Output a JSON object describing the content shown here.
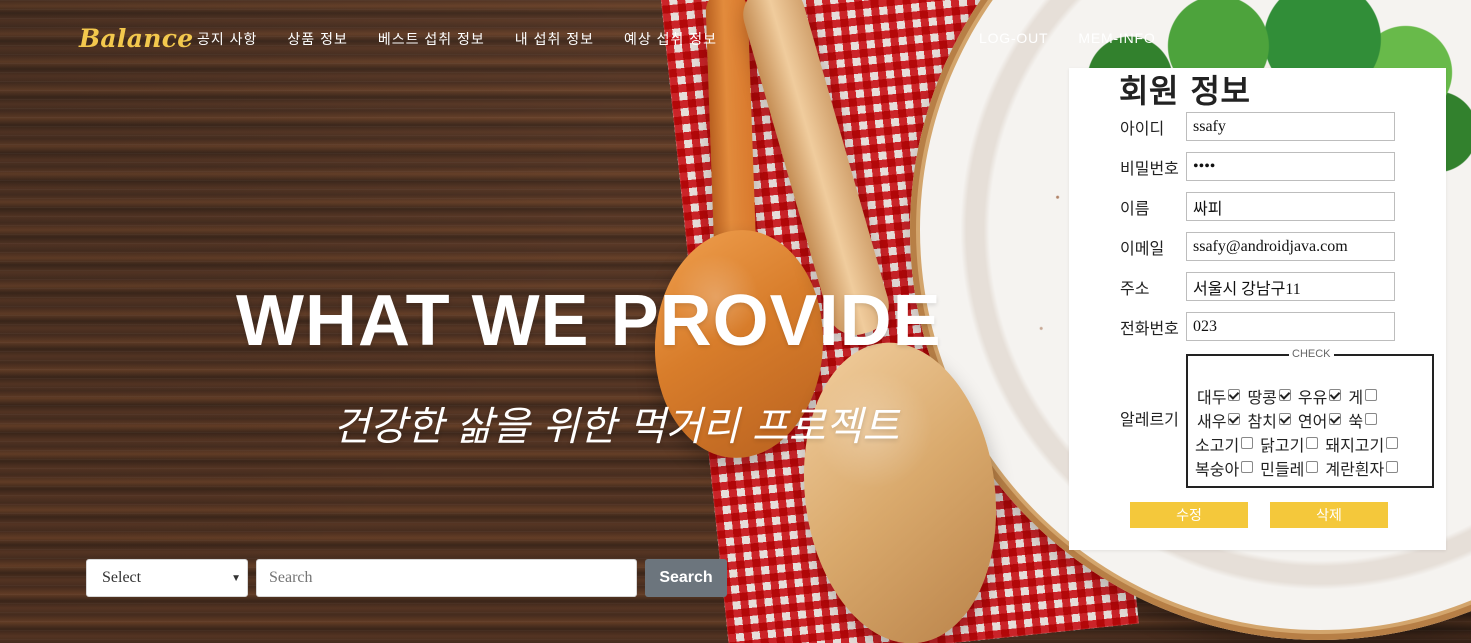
{
  "brand": {
    "logo": "Balance"
  },
  "navigation": {
    "items": [
      "공지 사항",
      "상품 정보",
      "베스트 섭취 정보",
      "내 섭취 정보",
      "예상 섭취 정보"
    ],
    "right_links": [
      "LOG-OUT",
      "MEM-INFO"
    ]
  },
  "hero": {
    "title": "WHAT WE PROVIDE",
    "subtitle": "건강한 삶을 위한 먹거리 프로젝트"
  },
  "search": {
    "select_value": "Select",
    "input_value": "",
    "input_placeholder": "Search",
    "button_label": "Search"
  },
  "member_info": {
    "title": "회원 정보",
    "fields": [
      {
        "label": "아이디",
        "value": "ssafy"
      },
      {
        "label": "비밀번호",
        "value": "••••"
      },
      {
        "label": "이름",
        "value": "싸피"
      },
      {
        "label": "이메일",
        "value": "ssafy@androidjava.com"
      },
      {
        "label": "주소",
        "value": "서울시 강남구11"
      },
      {
        "label": "전화번호",
        "value": "023"
      }
    ],
    "allergy": {
      "label": "알레르기",
      "legend": "CHECK",
      "rows": [
        [
          {
            "label": "대두",
            "checked": true
          },
          {
            "label": "땅콩",
            "checked": true
          },
          {
            "label": "우유",
            "checked": true
          },
          {
            "label": "게",
            "checked": false
          }
        ],
        [
          {
            "label": "새우",
            "checked": true
          },
          {
            "label": "참치",
            "checked": true
          },
          {
            "label": "연어",
            "checked": true
          },
          {
            "label": "쑥",
            "checked": false
          }
        ],
        [
          {
            "label": "소고기",
            "checked": false
          },
          {
            "label": "닭고기",
            "checked": false
          },
          {
            "label": "돼지고기",
            "checked": false
          }
        ],
        [
          {
            "label": "복숭아",
            "checked": false
          },
          {
            "label": "민들레",
            "checked": false
          },
          {
            "label": "계란흰자",
            "checked": false
          }
        ]
      ]
    },
    "buttons": {
      "edit": "수정",
      "delete": "삭제"
    }
  },
  "colors": {
    "logo": "#f3c84d",
    "search_button": "#6c757d",
    "action_buttons": "#f4c83b"
  }
}
